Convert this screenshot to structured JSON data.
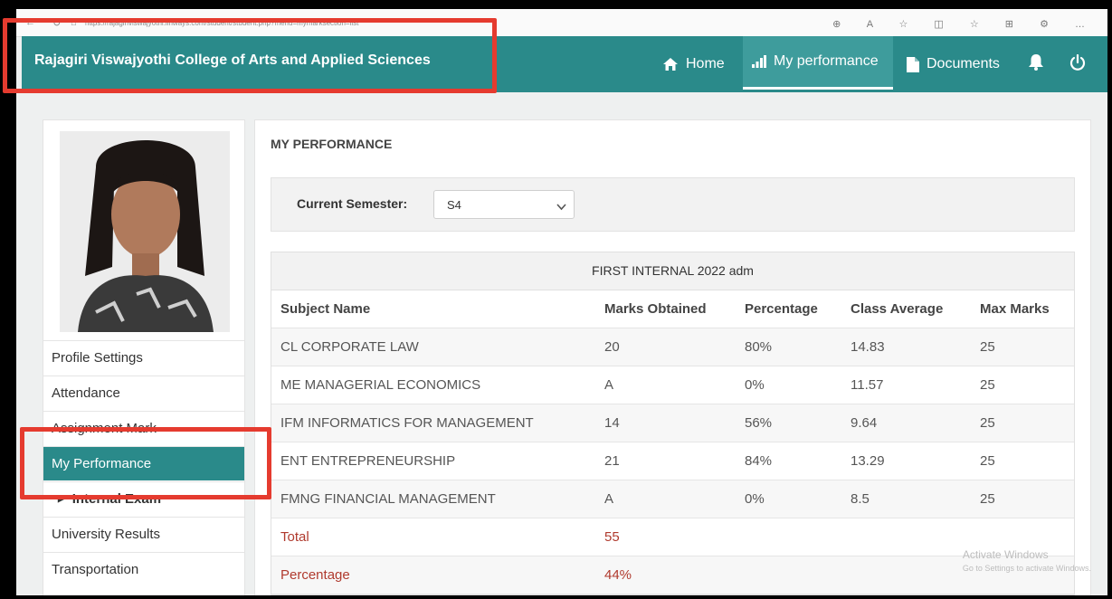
{
  "browser": {
    "url": "https://rajagiriviswajyothi.linways.com/student/student.php?menu=mymarksection=list"
  },
  "header": {
    "brand": "Rajagiri Viswajyothi College of Arts and Applied Sciences",
    "nav": [
      {
        "label": "Home",
        "icon": "home-icon"
      },
      {
        "label": "My performance",
        "icon": "bar-chart-icon",
        "active": true
      },
      {
        "label": "Documents",
        "icon": "document-icon"
      }
    ],
    "bell_icon": "bell-icon",
    "power_icon": "power-icon"
  },
  "sidebar": {
    "items": [
      {
        "label": "Profile Settings"
      },
      {
        "label": "Attendance"
      },
      {
        "label": "Assignment Mark"
      },
      {
        "label": "My Performance",
        "active": true
      },
      {
        "label": "Internal Exam",
        "sub": true
      },
      {
        "label": "University Results"
      },
      {
        "label": "Transportation"
      }
    ]
  },
  "main": {
    "title": "MY PERFORMANCE",
    "semester_label": "Current Semester:",
    "semester_value": "S4",
    "exam_title": "FIRST INTERNAL 2022 adm",
    "columns": [
      "Subject Name",
      "Marks Obtained",
      "Percentage",
      "Class Average",
      "Max Marks"
    ],
    "rows": [
      [
        "CL CORPORATE LAW",
        "20",
        "80%",
        "14.83",
        "25"
      ],
      [
        "ME MANAGERIAL ECONOMICS",
        "A",
        "0%",
        "11.57",
        "25"
      ],
      [
        "IFM INFORMATICS FOR MANAGEMENT",
        "14",
        "56%",
        "9.64",
        "25"
      ],
      [
        "ENT ENTREPRENEURSHIP",
        "21",
        "84%",
        "13.29",
        "25"
      ],
      [
        "FMNG FINANCIAL MANAGEMENT",
        "A",
        "0%",
        "8.5",
        "25"
      ]
    ],
    "total_label": "Total",
    "total_value": "55",
    "percentage_label": "Percentage",
    "percentage_value": "44%"
  },
  "watermark": {
    "line1": "Activate Windows",
    "line2": "Go to Settings to activate Windows."
  },
  "colors": {
    "theme": "#2a8a8a",
    "highlight": "#e53b2f",
    "total_text": "#b03a2e"
  }
}
